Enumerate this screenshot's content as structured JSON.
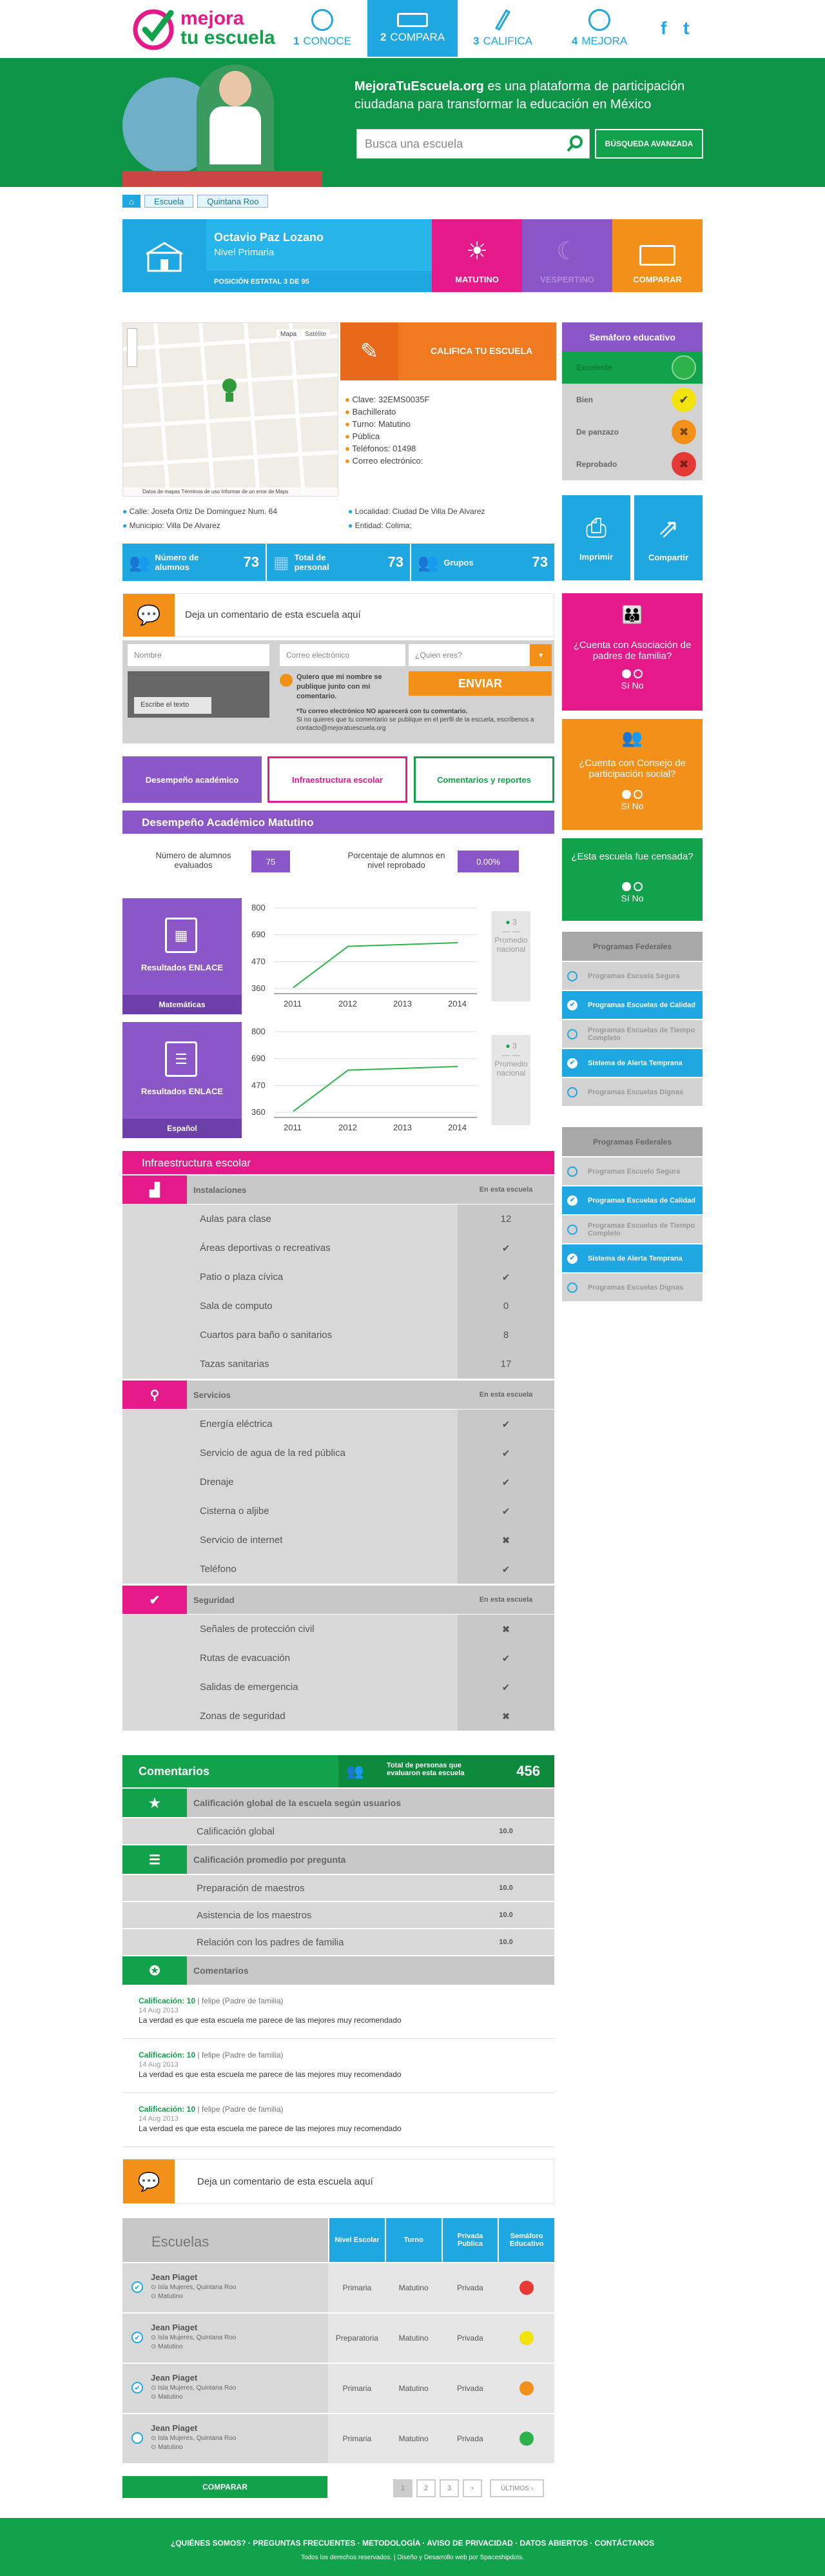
{
  "header": {
    "logo_top": "mejora",
    "logo_bottom": "tu escuela",
    "nav": [
      {
        "num": "1",
        "label": "CONOCE"
      },
      {
        "num": "2",
        "label": "COMPARA"
      },
      {
        "num": "3",
        "label": "CALIFICA"
      },
      {
        "num": "4",
        "label": "MEJORA"
      }
    ],
    "social": [
      "f",
      "t"
    ]
  },
  "hero": {
    "brand": "MejoraTuEscuela.org",
    "desc": " es una plataforma de participación ciudadana para transformar la educación en México",
    "search_placeholder": "Busca una escuela",
    "advanced": "BÚSQUEDA AVANZADA"
  },
  "breadcrumb": [
    "Escuela",
    "Quintana Roo"
  ],
  "school": {
    "name": "Octavio Paz Lozano",
    "level": "Nivel Primaria",
    "position": "POSICIÓN ESTATAL 3 DE 95",
    "shifts": [
      "MATUTINO",
      "VESPERTINO"
    ],
    "compare": "COMPARAR"
  },
  "map": {
    "btn_map": "Mapa",
    "btn_sat": "Satélite",
    "footer": "Datos de mapas    Términos de uso    Informar de un error de Maps"
  },
  "califica": "CALIFICA TU ESCUELA",
  "details": [
    "Clave: 32EMS0035F",
    "Bachillerato",
    "Turno: Matutino",
    "Pública",
    "Teléfonos: 01498",
    "Correo electrónico:"
  ],
  "address": [
    "Calle: Josefa Ortiz De Dominguez Num. 64",
    "Localidad: Ciudad De Villa De Alvarez",
    "Municipio: Villa De Alvarez",
    "Entidad: Colima;"
  ],
  "stats": [
    {
      "label": "Número de alumnos",
      "value": "73"
    },
    {
      "label": "Total de personal",
      "value": "73"
    },
    {
      "label": "Grupos",
      "value": "73"
    }
  ],
  "semaforo": {
    "title": "Semáforo educativo",
    "levels": [
      "Excelente",
      "Bien",
      "De panzazo",
      "Reprobado"
    ]
  },
  "actions": {
    "print": "Imprimir",
    "share": "Compartir"
  },
  "comment_box": {
    "prompt": "Deja un comentario de esta escuela aquí",
    "name_ph": "Nombre",
    "email_ph": "Correo electrónico",
    "who_ph": "¿Quien eres?",
    "captcha": "Escribe el texto",
    "publish_note": "Quiero que mi nombre se publique junto con mi comentario.",
    "send": "ENVIAR",
    "disclaimer_b": "*Tu correo electrónico NO aparecerá con tu comentario.",
    "disclaimer": "Si no quieres que tu comentario se publique en el perfil de la escuela, escríbenos a contacto@mejoratuescuela.org"
  },
  "tabs": [
    "Desempeño académico",
    "Infraestructura escolar",
    "Comentarios y reportes"
  ],
  "desempeno": {
    "title": "Desempeño Académico Matutino",
    "evaluated_label": "Número de alumnos evaluados",
    "evaluated": "75",
    "reprob_label": "Porcentaje de alumnos en nivel reprobado",
    "reprob": "0.00%"
  },
  "enlace": [
    {
      "label": "Resultados ENLACE",
      "subject": "Matemáticas",
      "rank": "3",
      "rank_label": "Promedio nacional"
    },
    {
      "label": "Resultados ENLACE",
      "subject": "Español",
      "rank": "3",
      "rank_label": "Promedio nacional"
    }
  ],
  "chart_data": [
    {
      "type": "line",
      "categories": [
        "2011",
        "2012",
        "2013",
        "2014"
      ],
      "values": [
        365,
        590,
        600,
        610
      ],
      "yticks": [
        "800",
        "690",
        "470",
        "360"
      ],
      "ylim": [
        360,
        800
      ]
    },
    {
      "type": "line",
      "categories": [
        "2011",
        "2012",
        "2013",
        "2014"
      ],
      "values": [
        365,
        590,
        600,
        610
      ],
      "yticks": [
        "800",
        "690",
        "470",
        "360"
      ],
      "ylim": [
        360,
        800
      ]
    }
  ],
  "questions": [
    {
      "title": "¿Cuenta con Asociación de padres de familia?",
      "yes": "Sí",
      "no": "No",
      "color": "#e5198a"
    },
    {
      "title": "¿Cuenta con Consejo de participación social?",
      "yes": "Sí",
      "no": "No",
      "color": "#f39019"
    },
    {
      "title": "¿Esta escuela fue censada?",
      "yes": "Sí",
      "no": "No",
      "color": "#12a24b"
    }
  ],
  "programs": [
    {
      "title": "Programas Federales",
      "items": [
        {
          "label": "Programas Escuela Segura",
          "on": false
        },
        {
          "label": "Programas Escuelas de Calidad",
          "on": true
        },
        {
          "label": "Programas Escuelas de Tiempo Completo",
          "on": false
        },
        {
          "label": "Sistema de Alerta Temprana",
          "on": true
        },
        {
          "label": "Programas Escuelas Dignas",
          "on": false
        }
      ]
    },
    {
      "title": "Programas Federales",
      "items": [
        {
          "label": "Programas Escuelo Segura",
          "on": false
        },
        {
          "label": "Programas Escuelas de Calidad",
          "on": true
        },
        {
          "label": "Programas Escuelas de Tiempo Completo",
          "on": false
        },
        {
          "label": "Sistema de Alerta Temprana",
          "on": true
        },
        {
          "label": "Programas Escuelas Dignas",
          "on": false
        }
      ]
    }
  ],
  "infra": {
    "title": "Infraestructura escolar",
    "col": "En esta escuela",
    "groups": [
      {
        "name": "Instalaciones",
        "rows": [
          {
            "l": "Aulas para clase",
            "v": "12"
          },
          {
            "l": "Áreas deportivas o recreativas",
            "v": "✔"
          },
          {
            "l": "Patio o plaza cívica",
            "v": "✔"
          },
          {
            "l": "Sala de computo",
            "v": "0"
          },
          {
            "l": "Cuartos para baño o sanitarios",
            "v": "8"
          },
          {
            "l": "Tazas sanitarias",
            "v": "17"
          }
        ]
      },
      {
        "name": "Servicios",
        "rows": [
          {
            "l": "Energía eléctrica",
            "v": "✔"
          },
          {
            "l": "Servicio de agua de la red pública",
            "v": "✔"
          },
          {
            "l": "Drenaje",
            "v": "✔"
          },
          {
            "l": "Cisterna o aljibe",
            "v": "✔"
          },
          {
            "l": "Servicio de internet",
            "v": "✖"
          },
          {
            "l": "Teléfono",
            "v": "✔"
          }
        ]
      },
      {
        "name": "Seguridad",
        "rows": [
          {
            "l": "Señales de protección civil",
            "v": "✖"
          },
          {
            "l": "Rutas de evacuación",
            "v": "✔"
          },
          {
            "l": "Salidas de emergencia",
            "v": "✔"
          },
          {
            "l": "Zonas de seguridad",
            "v": "✖"
          }
        ]
      }
    ]
  },
  "comentarios": {
    "title": "Comentarios",
    "total_label": "Total de personas que evaluaron esta escuela",
    "total": "456",
    "global_title": "Calificación global de la escuela según usuarios",
    "global_label": "Calificación global",
    "global_val": "10.0",
    "avg_title": "Calificación promedio por pregunta",
    "avg": [
      {
        "l": "Preparación de maestros",
        "v": "10.0"
      },
      {
        "l": "Asistencia de los maestros",
        "v": "10.0"
      },
      {
        "l": "Relación con los padres de familia",
        "v": "10.0"
      }
    ],
    "list_title": "Comentarios",
    "list": [
      {
        "cal": "Calificación: 10",
        "who": "felipe (Padre de familia)",
        "date": "14 Aug 2013",
        "text": "La verdad es que esta escuela me parece de las mejores muy recomendado"
      },
      {
        "cal": "Calificación: 10",
        "who": "felipe (Padre de familia)",
        "date": "14 Aug 2013",
        "text": "La verdad es que esta escuela me parece de las mejores muy recomendado"
      },
      {
        "cal": "Calificación: 10",
        "who": "felipe (Padre de familia)",
        "date": "14 Aug 2013",
        "text": "La verdad es que esta escuela me parece de las mejores muy recomendado"
      }
    ],
    "leave": "Deja un comentario de esta escuela aquí"
  },
  "compare": {
    "title": "Escuelas",
    "cols": [
      "Nivel Escolar",
      "Turno",
      "Privada Publica",
      "Semáforo Educativo"
    ],
    "rows": [
      {
        "name": "Jean Piaget",
        "loc": "Isla Mujeres, Quintana Roo",
        "shift": "Matutino",
        "level": "Primaria",
        "turno": "Matutino",
        "type": "Privada",
        "sem": "#e53935"
      },
      {
        "name": "Jean Piaget",
        "loc": "Isla Mujeres, Quintana Roo",
        "shift": "Matutino",
        "level": "Preparatoria",
        "turno": "Matutino",
        "type": "Privada",
        "sem": "#f2e30c"
      },
      {
        "name": "Jean Piaget",
        "loc": "Isla Mujeres, Quintana Roo",
        "shift": "Matutino",
        "level": "Primaria",
        "turno": "Matutino",
        "type": "Privada",
        "sem": "#f39019"
      },
      {
        "name": "Jean Piaget",
        "loc": "Isla Mujeres, Quintana Roo",
        "shift": "Matutino",
        "level": "Primaria",
        "turno": "Matutino",
        "type": "Privada",
        "sem": "#2db34a"
      }
    ],
    "button": "COMPARAR",
    "pages": [
      "1",
      "2",
      "3",
      "›"
    ],
    "last": "ÚLTIMOS ›"
  },
  "footer": {
    "links": "¿QUIÉNES SOMOS?  ·  PREGUNTAS FRECUENTES  ·  METODOLOGÍA  ·  AVISO DE PRIVACIDAD  ·  DATOS ABIERTOS  ·  CONTÁCTANOS",
    "legal": "Todos los derechos reservados.  |  Diseño y Desarrollo web por Spaceshipdots."
  }
}
